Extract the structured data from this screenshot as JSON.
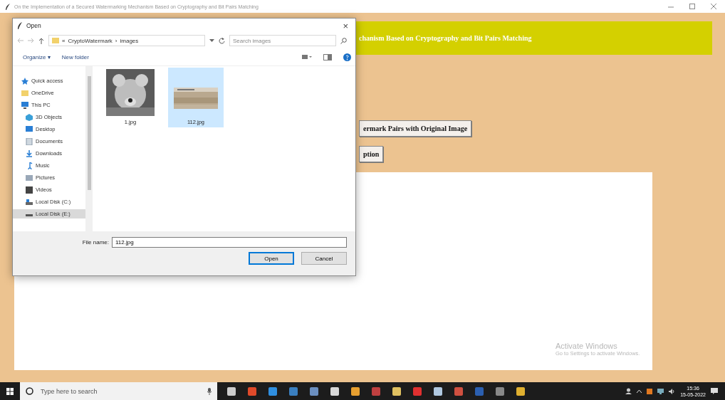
{
  "window": {
    "title": "On the Implementation of a Secured Watermarking Mechanism Based on Cryptography and Bit Pairs Matching"
  },
  "app": {
    "banner": "chanism Based on Cryptography and Bit Pairs Matching",
    "buttons": [
      "ermark Pairs with Original Image",
      "ption"
    ]
  },
  "dialog": {
    "title": "Open",
    "close": "×",
    "path": [
      "«",
      "CryptoWatermark",
      "›",
      "images"
    ],
    "search": {
      "placeholder": "Search images"
    },
    "toolbar": [
      "Organize ▾",
      "New folder"
    ],
    "sidebar": [
      {
        "label": "Quick access",
        "selected": false
      },
      {
        "label": "OneDrive",
        "selected": false
      },
      {
        "label": "This PC",
        "selected": false,
        "children": [
          {
            "label": "3D Objects",
            "selected": false
          },
          {
            "label": "Desktop",
            "selected": false
          },
          {
            "label": "Documents",
            "selected": false
          },
          {
            "label": "Downloads",
            "selected": false
          },
          {
            "label": "Music",
            "selected": false
          },
          {
            "label": "Pictures",
            "selected": false
          },
          {
            "label": "Videos",
            "selected": false
          },
          {
            "label": "Local Disk (C:)",
            "selected": false
          },
          {
            "label": "Local Disk (E:)",
            "selected": true
          }
        ]
      }
    ],
    "files": [
      {
        "name": "1.jpg",
        "selected": false
      },
      {
        "name": "112.jpg",
        "selected": true
      }
    ],
    "file_name_label": "File name:",
    "file_name": "112.jpg",
    "buttons": [
      "Open",
      "Cancel"
    ]
  },
  "watermark": {
    "title": "Activate Windows",
    "subtitle": "Go to Settings to activate Windows."
  },
  "taskbar": {
    "search": {
      "placeholder": "Type here to search"
    },
    "time": "15:36",
    "date": "15-05-2022"
  }
}
